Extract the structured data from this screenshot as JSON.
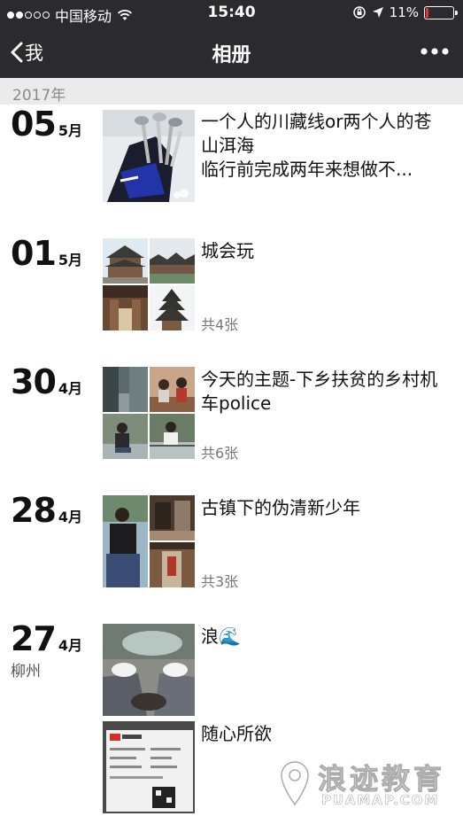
{
  "status_bar": {
    "carrier": "中国移动",
    "time": "15:40",
    "battery_text": "11%",
    "battery_level": 0.11,
    "colors": {
      "bar": "#2b2a2f",
      "battery_low": "#e8342e"
    }
  },
  "nav": {
    "back_label": "我",
    "title": "相册"
  },
  "year_header": "2017年",
  "posts": [
    {
      "day": "05",
      "month": "5月",
      "text": "一个人的川藏线or两个人的苍山洱海\n临行前完成两年来想做不...",
      "count": "",
      "location": ""
    },
    {
      "day": "01",
      "month": "5月",
      "text": "城会玩",
      "count": "共4张",
      "location": ""
    },
    {
      "day": "30",
      "month": "4月",
      "text": "今天的主题-下乡扶贫的乡村机车police",
      "count": "共6张",
      "location": ""
    },
    {
      "day": "28",
      "month": "4月",
      "text": "古镇下的伪清新少年",
      "count": "共3张",
      "location": ""
    },
    {
      "day": "27",
      "month": "4月",
      "location": "柳州",
      "entries": [
        {
          "text": "浪🌊"
        },
        {
          "text": "随心所欲"
        }
      ]
    }
  ],
  "watermark": {
    "title": "浪迹教育",
    "subtitle": "PUAMAP.COM"
  }
}
